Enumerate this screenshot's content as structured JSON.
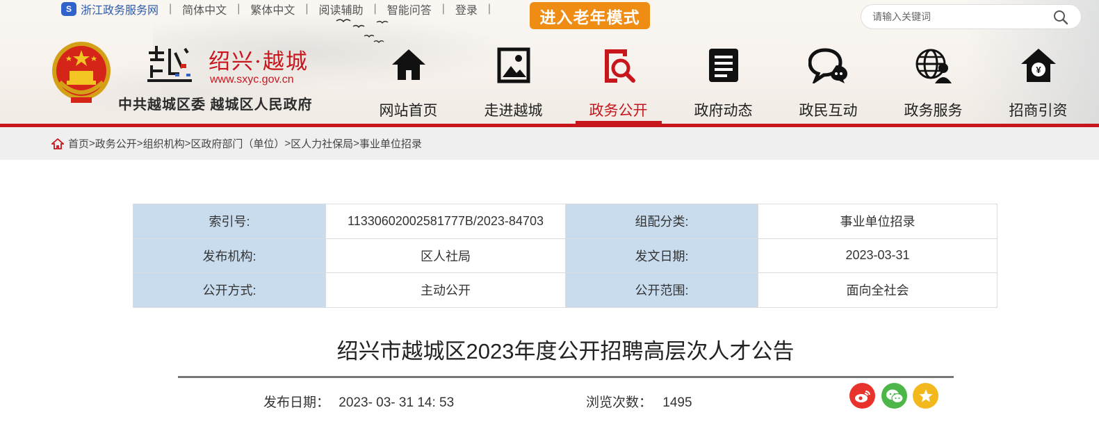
{
  "header": {
    "portal_link": "浙江政务服务网",
    "lang_links": [
      "简体中文",
      "繁体中文",
      "阅读辅助",
      "智能问答",
      "登录"
    ],
    "elder_mode": "进入老年模式",
    "search_placeholder": "请输入关键词",
    "logo_title": "绍兴·越城",
    "logo_url": "www.sxyc.gov.cn",
    "logo_org": "中共越城区委 越城区人民政府",
    "nav": [
      {
        "label": "网站首页",
        "icon": "home-icon"
      },
      {
        "label": "走进越城",
        "icon": "picture-icon"
      },
      {
        "label": "政务公开",
        "icon": "search-doc-icon",
        "active": true
      },
      {
        "label": "政府动态",
        "icon": "document-icon"
      },
      {
        "label": "政民互动",
        "icon": "chat-icon"
      },
      {
        "label": "政务服务",
        "icon": "globe-person-icon"
      },
      {
        "label": "招商引资",
        "icon": "house-yen-icon"
      }
    ]
  },
  "breadcrumb": [
    "首页",
    "政务公开",
    "组织机构",
    "区政府部门（单位）",
    "区人力社保局",
    "事业单位招录"
  ],
  "info": {
    "rows": [
      {
        "l1": "索引号:",
        "v1": "11330602002581777B/2023-84703",
        "l2": "组配分类:",
        "v2": "事业单位招录"
      },
      {
        "l1": "发布机构:",
        "v1": "区人社局",
        "l2": "发文日期:",
        "v2": "2023-03-31"
      },
      {
        "l1": "公开方式:",
        "v1": "主动公开",
        "l2": "公开范围:",
        "v2": "面向全社会"
      }
    ]
  },
  "article": {
    "title": "绍兴市越城区2023年度公开招聘高层次人才公告",
    "publish_label": "发布日期：",
    "publish_value": "2023- 03- 31 14: 53",
    "views_label": "浏览次数：",
    "views_value": "1495"
  },
  "share": [
    "weibo-icon",
    "wechat-icon",
    "favorite-icon"
  ],
  "colors": {
    "brand_red": "#c8161d",
    "elder_orange": "#ef8c14",
    "table_label_bg": "#c9dcee"
  }
}
